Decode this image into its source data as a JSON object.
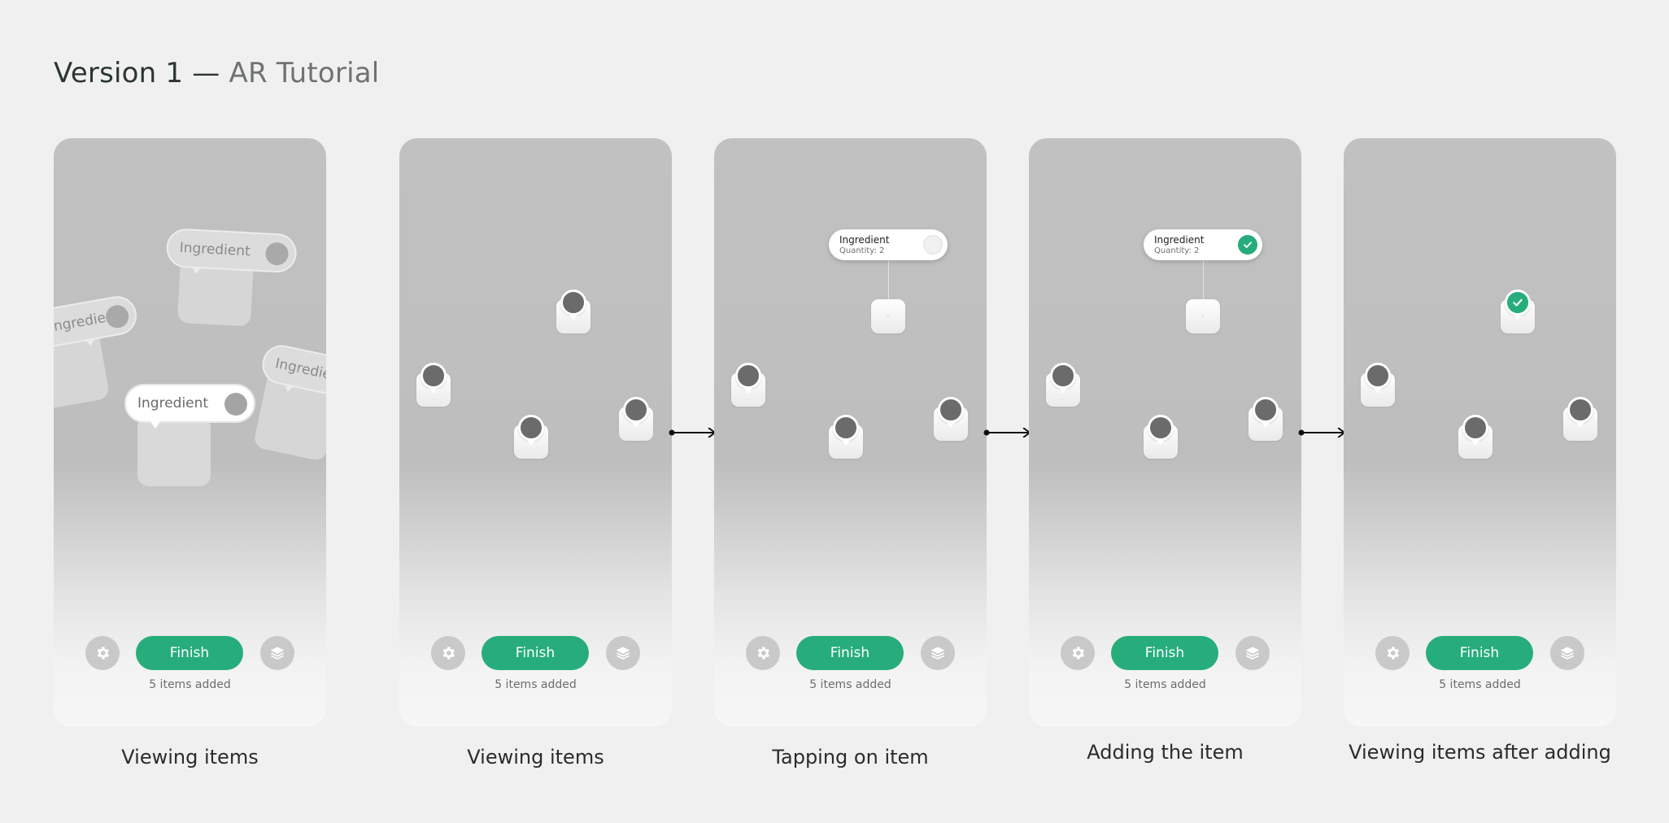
{
  "header": {
    "title": "Version 1",
    "separator": "—",
    "subtitle": "AR Tutorial"
  },
  "colors": {
    "accent": "#27ad7b",
    "background": "#f0f0f0",
    "marker": "#6b6b6b"
  },
  "controls": {
    "finish_label": "Finish",
    "items_added": "5 items added",
    "settings_icon": "gear-icon",
    "layers_icon": "layers-icon"
  },
  "frames": [
    {
      "caption": "Viewing items",
      "bubbles": [
        "Ingredient",
        "Ingredient",
        "Ingredient",
        "Ingredient"
      ]
    },
    {
      "caption": "Viewing items"
    },
    {
      "caption": "Tapping on item",
      "popup": {
        "name": "Ingredient",
        "quantity": "Quantity: 2",
        "checked": false
      }
    },
    {
      "caption": "Adding the item",
      "popup": {
        "name": "Ingredient",
        "quantity": "Quantity: 2",
        "checked": true
      }
    },
    {
      "caption": "Viewing items after adding"
    }
  ]
}
